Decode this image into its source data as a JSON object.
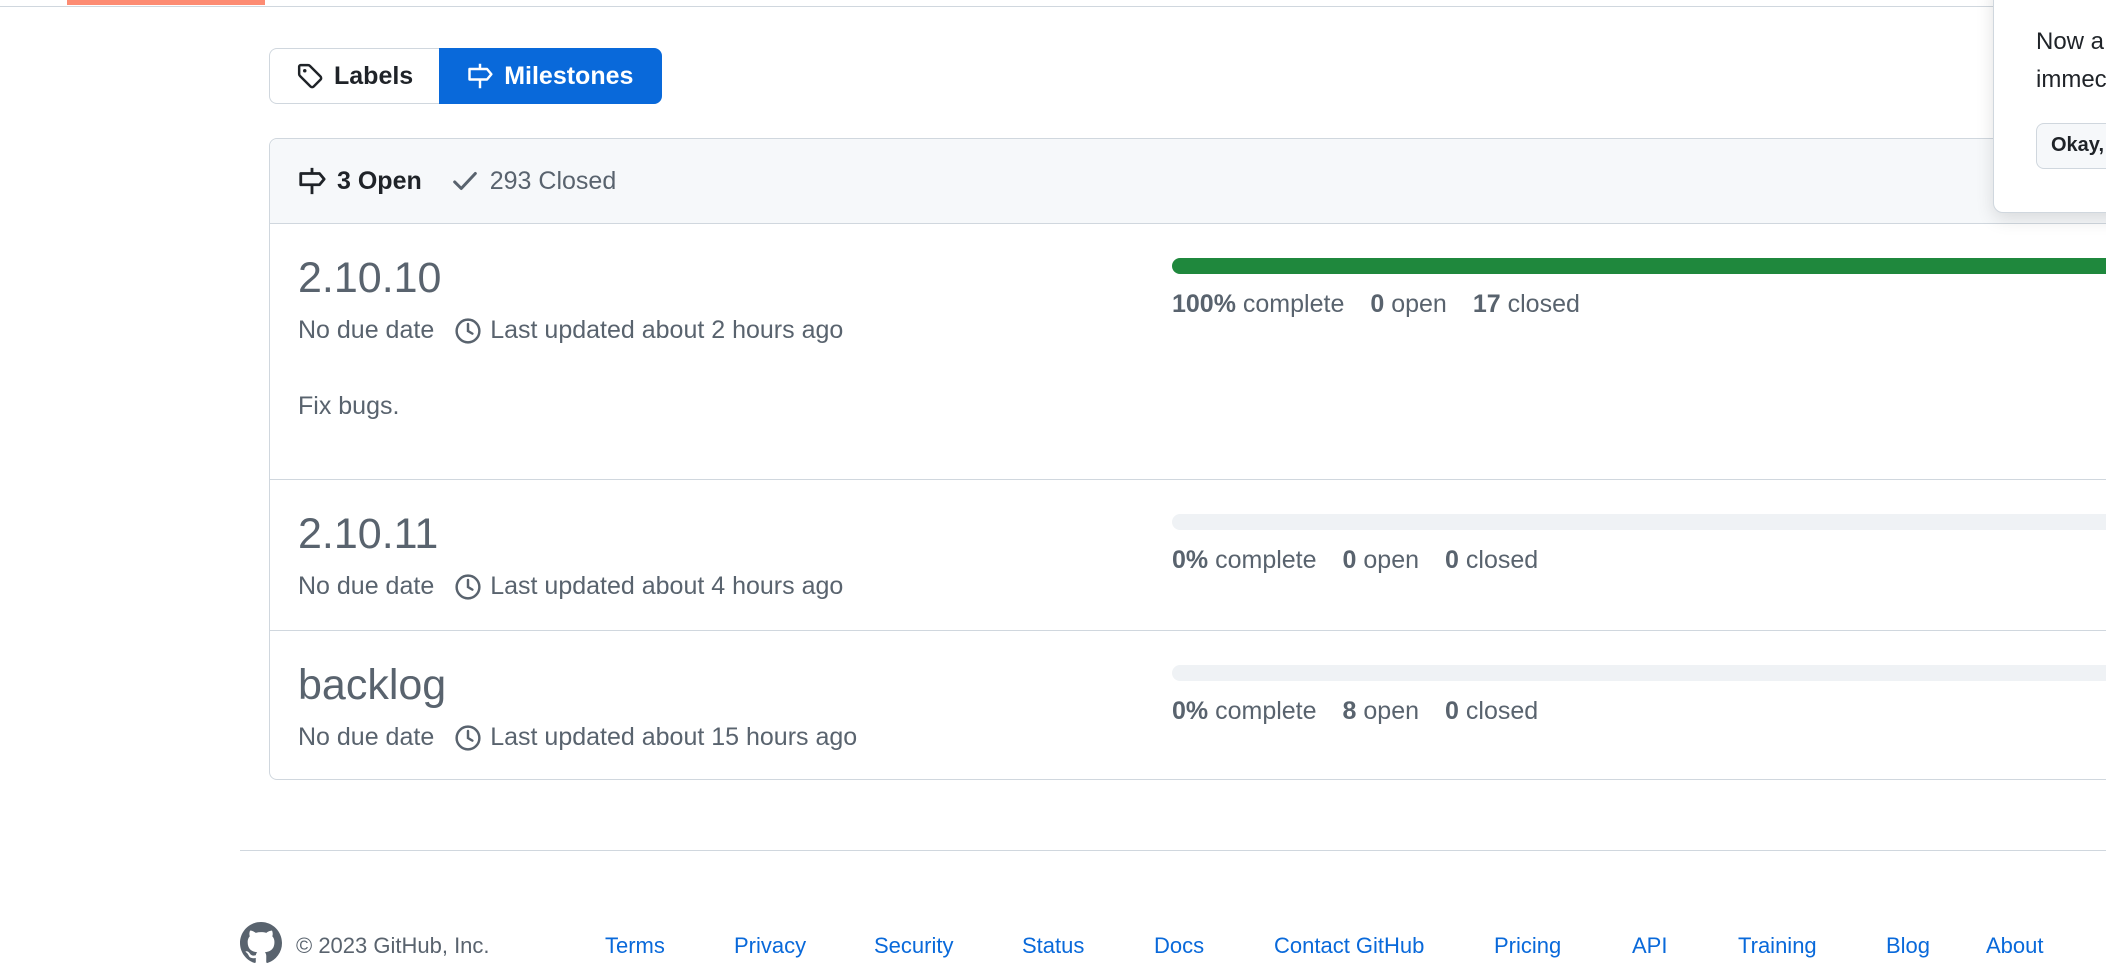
{
  "subnav": {
    "labels": "Labels",
    "milestones": "Milestones"
  },
  "states": {
    "open": "3 Open",
    "closed": "293 Closed"
  },
  "milestones": [
    {
      "title": "2.10.10",
      "due": "No due date",
      "updated": "Last updated about 2 hours ago",
      "description": "Fix bugs.",
      "progress_percent": 100,
      "complete_value": "100%",
      "complete_label": "complete",
      "open_value": "0",
      "open_label": "open",
      "closed_value": "17",
      "closed_label": "closed"
    },
    {
      "title": "2.10.11",
      "due": "No due date",
      "updated": "Last updated about 4 hours ago",
      "description": "",
      "progress_percent": 0,
      "complete_value": "0%",
      "complete_label": "complete",
      "open_value": "0",
      "open_label": "open",
      "closed_value": "0",
      "closed_label": "closed"
    },
    {
      "title": "backlog",
      "due": "No due date",
      "updated": "Last updated about 15 hours ago",
      "description": "",
      "progress_percent": 0,
      "complete_value": "0%",
      "complete_label": "complete",
      "open_value": "8",
      "open_label": "open",
      "closed_value": "0",
      "closed_label": "closed"
    }
  ],
  "footer": {
    "copyright": "© 2023 GitHub, Inc.",
    "links": [
      "Terms",
      "Privacy",
      "Security",
      "Status",
      "Docs",
      "Contact GitHub",
      "Pricing",
      "API",
      "Training",
      "Blog",
      "About"
    ]
  },
  "popover": {
    "line1": "Now a",
    "line2": "immec",
    "button": "Okay,"
  },
  "colors": {
    "accent": "#0969da",
    "progress": "#1f883d",
    "underline": "#fd8c73",
    "muted": "#59636e"
  }
}
